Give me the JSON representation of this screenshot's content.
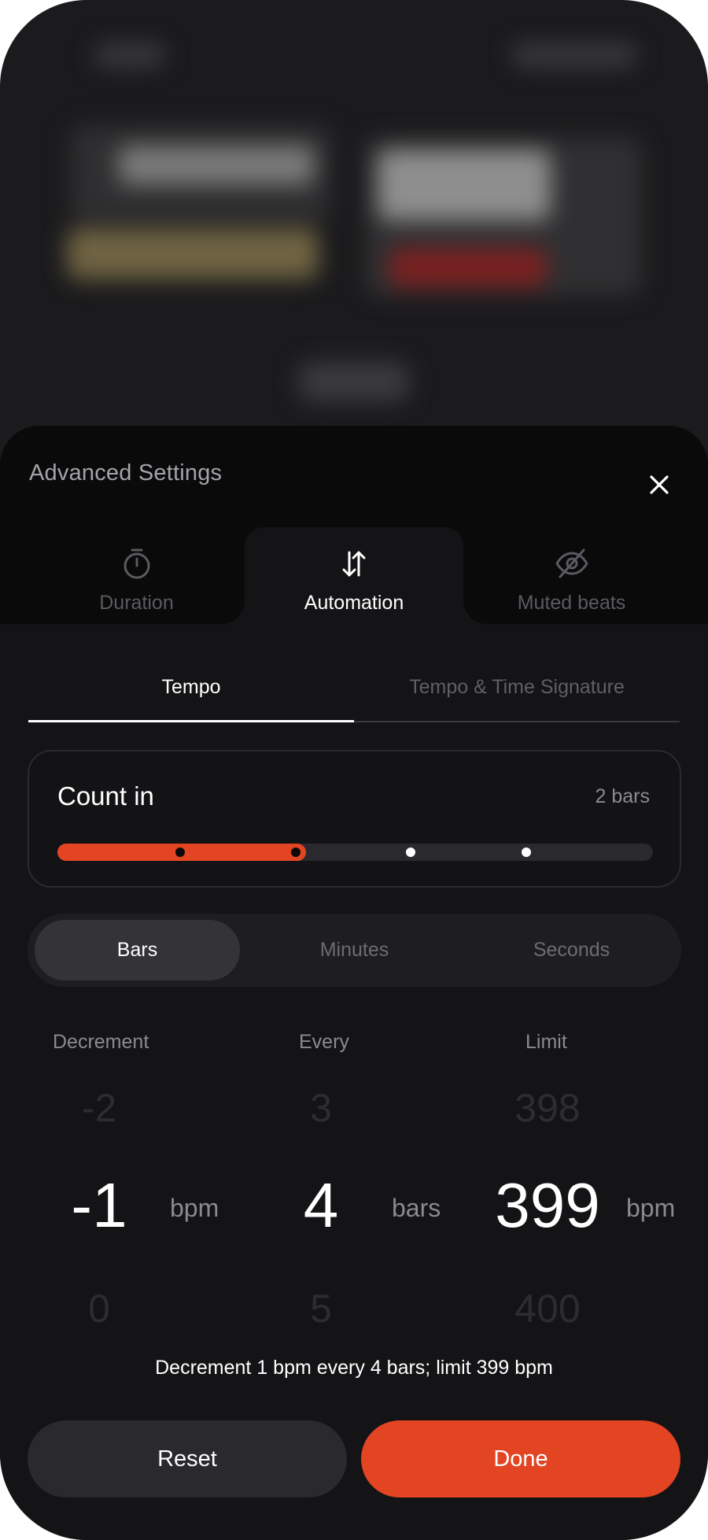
{
  "sheet": {
    "title": "Advanced Settings"
  },
  "main_tabs": [
    {
      "label": "Duration",
      "icon": "stopwatch-icon",
      "active": false
    },
    {
      "label": "Automation",
      "icon": "arrows-up-down-icon",
      "active": true
    },
    {
      "label": "Muted beats",
      "icon": "eye-off-icon",
      "active": false
    }
  ],
  "sub_tabs": [
    {
      "label": "Tempo",
      "active": true
    },
    {
      "label": "Tempo & Time Signature",
      "active": false
    }
  ],
  "count_in": {
    "label": "Count in",
    "value": "2 bars",
    "selected_index": 1,
    "steps": 4
  },
  "units": [
    {
      "label": "Bars",
      "active": true
    },
    {
      "label": "Minutes",
      "active": false
    },
    {
      "label": "Seconds",
      "active": false
    }
  ],
  "pickers": {
    "decrement": {
      "header": "Decrement",
      "prev": "-2",
      "current": "-1",
      "next": "0",
      "unit": "bpm"
    },
    "every": {
      "header": "Every",
      "prev": "3",
      "current": "4",
      "next": "5",
      "unit": "bars"
    },
    "limit": {
      "header": "Limit",
      "prev": "398",
      "current": "399",
      "next": "400",
      "unit": "bpm"
    }
  },
  "summary": "Decrement 1 bpm every 4 bars; limit 399 bpm",
  "buttons": {
    "reset": "Reset",
    "done": "Done"
  },
  "colors": {
    "accent": "#e34422",
    "sheet_bg": "#141416",
    "header_bg": "#0a0a0b"
  }
}
